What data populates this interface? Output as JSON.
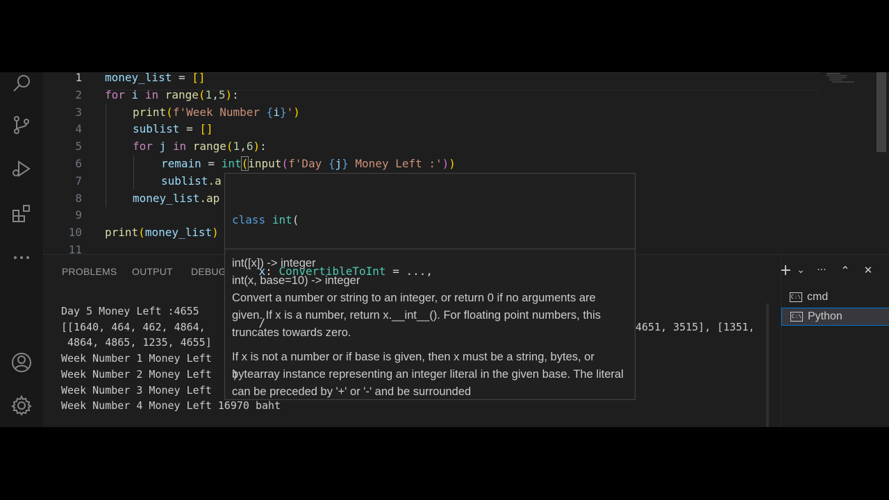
{
  "editor": {
    "line_numbers": [
      "1",
      "2",
      "3",
      "4",
      "5",
      "6",
      "7",
      "8",
      "9",
      "10",
      "11"
    ],
    "lines": {
      "l1": {
        "a": "money_list",
        "b": " = ",
        "c": "[]"
      },
      "l2": {
        "a": "for",
        "b": " ",
        "c": "i",
        "d": " ",
        "e": "in",
        "f": " ",
        "g": "range",
        "h": "(",
        "i": "1",
        "j": ",",
        "k": "5",
        "l": ")",
        "m": ":"
      },
      "l3": {
        "a": "print",
        "b": "(",
        "c": "f'Week Number ",
        "d": "{",
        "e": "i",
        "f": "}",
        "g": "'",
        "h": ")"
      },
      "l4": {
        "a": "sublist",
        "b": " = ",
        "c": "[]"
      },
      "l5": {
        "a": "for",
        "b": " ",
        "c": "j",
        "d": " ",
        "e": "in",
        "f": " ",
        "g": "range",
        "h": "(",
        "i": "1",
        "j": ",",
        "k": "6",
        "l": ")",
        "m": ":"
      },
      "l6": {
        "a": "remain",
        "b": " = ",
        "c": "int",
        "d": "(",
        "e": "input",
        "f": "(",
        "g": "f'Day ",
        "h": "{",
        "i": "j",
        "j": "}",
        "k": " Money Left :'",
        "l": ")",
        "m": ")"
      },
      "l7": {
        "a": "sublist",
        "b": ".a"
      },
      "l8": {
        "a": "money_list",
        "b": ".ap"
      },
      "l10": {
        "a": "print",
        "b": "(",
        "c": "money_list",
        "d": ")",
        "e": ")"
      }
    }
  },
  "panel": {
    "tabs": [
      "PROBLEMS",
      "OUTPUT",
      "DEBUG"
    ],
    "actions": {
      "add": "+",
      "chevron": "⌄",
      "more": "···",
      "maximize": "⌃",
      "close": "✕"
    },
    "terminal_lines": [
      "Day 5 Money Left :4655",
      "[[1640, 464, 462, 4864,",
      " 4864, 4865, 1235, 4655]",
      "Week Number 1 Money Left",
      "Week Number 2 Money Left",
      "Week Number 3 Money Left",
      "Week Number 4 Money Left 16970 baht"
    ],
    "terminal_right": "4651, 3515], [1351,",
    "terminals": [
      {
        "icon": "C:\\",
        "label": "cmd",
        "selected": false
      },
      {
        "icon": "C:\\",
        "label": "Python",
        "selected": true
      }
    ]
  },
  "hover": {
    "code_lines": [
      "class int(",
      "    x: ConvertibleToInt = ...,",
      "    /",
      ")"
    ],
    "sig1": "int([x]) -> integer",
    "sig2": "int(x, base=10) -> integer",
    "para1": "Convert a number or string to an integer, or return 0 if no arguments are given. If x is a number, return x.__int__(). For floating point numbers, this truncates towards zero.",
    "para2": "If x is not a number or if base is given, then x must be a string, bytes, or bytearray instance representing an integer literal in the given base. The literal can be preceded by '+' or '-' and be surrounded"
  },
  "activity_icons": [
    "search-icon",
    "source-control-icon",
    "run-debug-icon",
    "extensions-icon",
    "more-icon",
    "accounts-icon",
    "settings-gear-icon"
  ]
}
